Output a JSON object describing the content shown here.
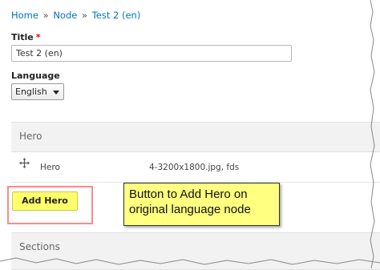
{
  "breadcrumb": {
    "items": [
      "Home",
      "Node",
      "Test 2 (en)"
    ],
    "separator": "»"
  },
  "form": {
    "title_label": "Title",
    "required_marker": "*",
    "title_value": "Test 2 (en)",
    "language_label": "Language",
    "language_value": "English"
  },
  "hero_section": {
    "heading": "Hero",
    "rows": [
      {
        "name": "Hero",
        "summary": "4-3200x1800.jpg, fds"
      }
    ],
    "add_button_label": "Add Hero",
    "add_button_color": "#ffff6a"
  },
  "callout": {
    "text": "Button to Add Hero on original language node",
    "background": "#ffff80"
  },
  "sections_section": {
    "heading": "Sections"
  },
  "colors": {
    "link": "#0074bd",
    "highlight_border": "#ff8a8a"
  }
}
